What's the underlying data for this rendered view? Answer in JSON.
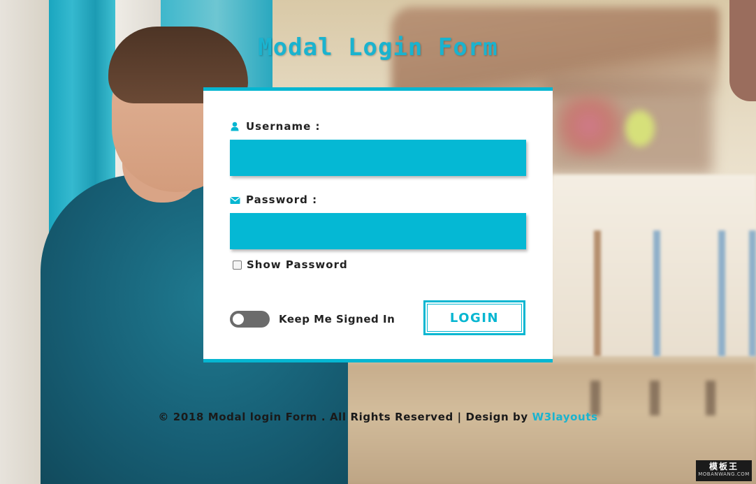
{
  "page": {
    "title": "Modal Login Form"
  },
  "form": {
    "username_label": "Username :",
    "password_label": "Password :",
    "username_value": "",
    "password_value": "",
    "show_password_label": "Show Password",
    "show_password_checked": false,
    "keep_signed_in_label": "Keep Me Signed In",
    "keep_signed_in_on": false,
    "login_button": "LOGIN",
    "icons": {
      "username": "user-icon",
      "password": "envelope-icon"
    }
  },
  "footer": {
    "text": "© 2018 Modal login Form . All Rights Reserved | Design by ",
    "link_text": "W3layouts"
  },
  "watermark": {
    "line1": "模板王",
    "line2": "MOBANWANG.COM"
  },
  "colors": {
    "accent": "#06b6d1",
    "toggle_off": "#6b6b6b",
    "text": "#222222"
  }
}
